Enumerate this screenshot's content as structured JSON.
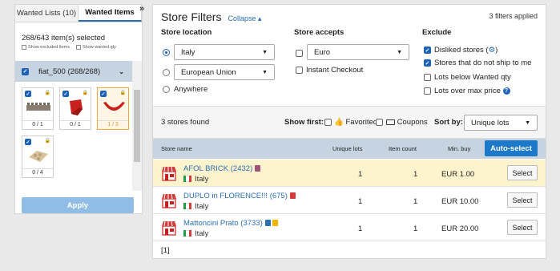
{
  "left_panel": {
    "tabs": [
      {
        "label": "Wanted Lists (10)"
      },
      {
        "label": "Wanted Items"
      }
    ],
    "collapse_glyph": "»",
    "selected_count": "268/643 item(s) selected",
    "show_excluded": "Show excluded items",
    "show_wanted_qty": "Show wanted qty",
    "group": {
      "label": "fiat_500 (268/268)"
    },
    "items": [
      {
        "qty": "0 / 1",
        "highlight": false,
        "color": "#8a7e72"
      },
      {
        "qty": "0 / 1",
        "highlight": false,
        "color": "#c8201d"
      },
      {
        "qty": "1 / 3",
        "highlight": true,
        "color": "#c8201d"
      },
      {
        "qty": "0 / 4",
        "highlight": false,
        "color": "#d8c29a"
      }
    ],
    "apply_label": "Apply"
  },
  "filters": {
    "title": "Store Filters",
    "collapse_label": "Collapse",
    "applied": "3 filters applied",
    "location": {
      "heading": "Store location",
      "country_value": "Italy",
      "region_value": "European Union",
      "anywhere_label": "Anywhere"
    },
    "accepts": {
      "heading": "Store accepts",
      "currency_value": "Euro",
      "instant_checkout_label": "Instant Checkout"
    },
    "exclude": {
      "heading": "Exclude",
      "options": [
        {
          "label": "Disliked stores",
          "checked": true
        },
        {
          "label": "Stores that do not ship to me",
          "checked": true
        },
        {
          "label": "Lots below Wanted qty",
          "checked": false
        },
        {
          "label": "Lots over max price",
          "checked": false
        }
      ]
    }
  },
  "results": {
    "found": "3 stores found",
    "show_first_label": "Show first:",
    "favorited_label": "Favorited",
    "coupons_label": "Coupons",
    "sort_by_label": "Sort by:",
    "sort_value": "Unique lots",
    "columns": {
      "store_name": "Store name",
      "unique_lots": "Unique lots",
      "item_count": "Item count",
      "min_buy": "Min. buy"
    },
    "auto_select_label": "Auto-select",
    "select_label": "Select",
    "stores": [
      {
        "name": "AFOL BRICK (2432)",
        "country": "Italy",
        "unique_lots": "1",
        "item_count": "1",
        "min_buy": "EUR 1.00",
        "highlight": true,
        "badges": [
          "#a0547a"
        ]
      },
      {
        "name": "DUPLO in FLORENCE!!! (675)",
        "country": "Italy",
        "unique_lots": "1",
        "item_count": "1",
        "min_buy": "EUR 10.00",
        "highlight": false,
        "badges": [
          "#d43b3b"
        ]
      },
      {
        "name": "Mattoncini Prato (3733)",
        "country": "Italy",
        "unique_lots": "1",
        "item_count": "1",
        "min_buy": "EUR 20.00",
        "highlight": false,
        "badges": [
          "#2a6fb0",
          "#f0b400"
        ]
      }
    ],
    "pager": "[1]"
  }
}
